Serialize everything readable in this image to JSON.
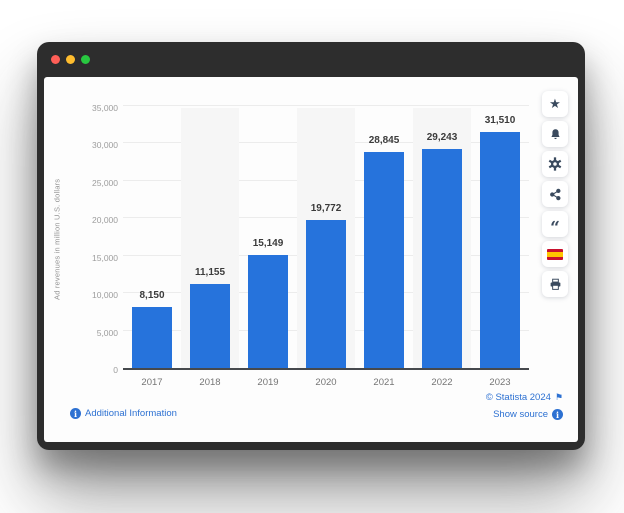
{
  "window": {
    "traffic_lights": {
      "close": "#ff5f57",
      "minimize": "#ffbd2e",
      "zoom": "#28c840"
    }
  },
  "chart_data": {
    "type": "bar",
    "title": "",
    "categories": [
      "2017",
      "2018",
      "2019",
      "2020",
      "2021",
      "2022",
      "2023"
    ],
    "values": [
      8150,
      11155,
      15149,
      19772,
      28845,
      29243,
      31510
    ],
    "value_labels": [
      "8,150",
      "11,155",
      "15,149",
      "19,772",
      "28,845",
      "29,243",
      "31,510"
    ],
    "xlabel": "",
    "ylabel": "Ad revenues in million U.S. dollars",
    "ylim": [
      0,
      35000
    ],
    "ytick_labels": [
      "0",
      "5,000",
      "10,000",
      "15,000",
      "20,000",
      "25,000",
      "30,000",
      "35,000"
    ],
    "grid": true,
    "legend": false,
    "bar_color": "#2673DC",
    "stripe_color": "#f6f6f6"
  },
  "toolbar": {
    "icons": [
      {
        "name": "favorite-star-icon"
      },
      {
        "name": "alert-bell-icon"
      },
      {
        "name": "settings-gear-icon"
      },
      {
        "name": "share-icon"
      },
      {
        "name": "citation-quote-icon"
      },
      {
        "name": "language-flag-spain-icon"
      },
      {
        "name": "print-icon"
      }
    ]
  },
  "footer": {
    "additional_info_label": "Additional Information",
    "copyright": "© Statista 2024",
    "show_source_label": "Show source"
  },
  "colors": {
    "accent_blue": "#2673DC",
    "link_blue": "#2d71d2",
    "icon_navy": "#3a4a5e",
    "frame_dark": "#2d2d2d"
  }
}
